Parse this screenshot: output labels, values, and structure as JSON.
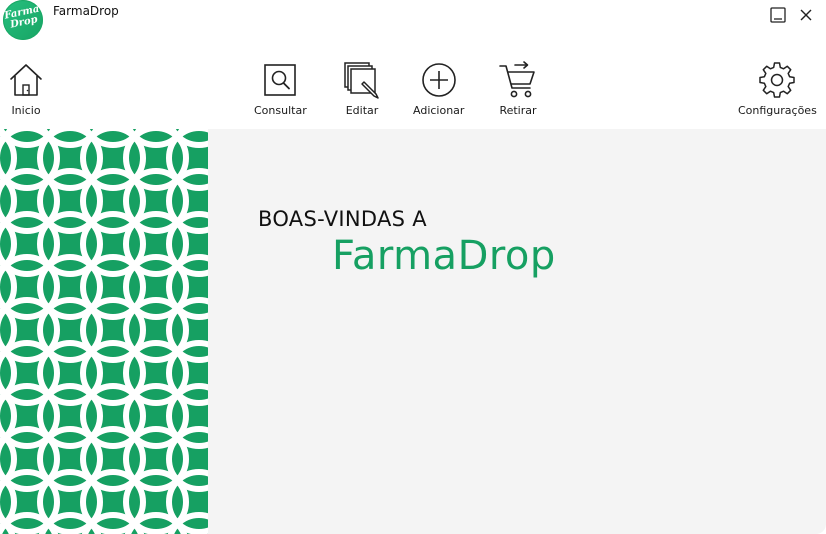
{
  "window": {
    "title": "FarmaDrop",
    "logo_text_line1": "Farma",
    "logo_text_line2": "Drop"
  },
  "toolbar": {
    "home_label": "Inicio",
    "consult_label": "Consultar",
    "edit_label": "Editar",
    "add_label": "Adicionar",
    "remove_label": "Retirar",
    "settings_label": "Configurações"
  },
  "welcome": {
    "line1": "BOAS-VINDAS A",
    "brand": "FarmaDrop"
  },
  "colors": {
    "brand_green": "#16a062",
    "pattern_lines": "#ffffff",
    "content_background": "#f4f4f4"
  },
  "icons": {
    "home": "home-icon",
    "consult": "search-icon",
    "edit": "edit-documents-icon",
    "add": "plus-circle-icon",
    "remove": "cart-remove-icon",
    "settings": "gear-icon",
    "minimize": "minimize-icon",
    "close": "close-icon"
  }
}
